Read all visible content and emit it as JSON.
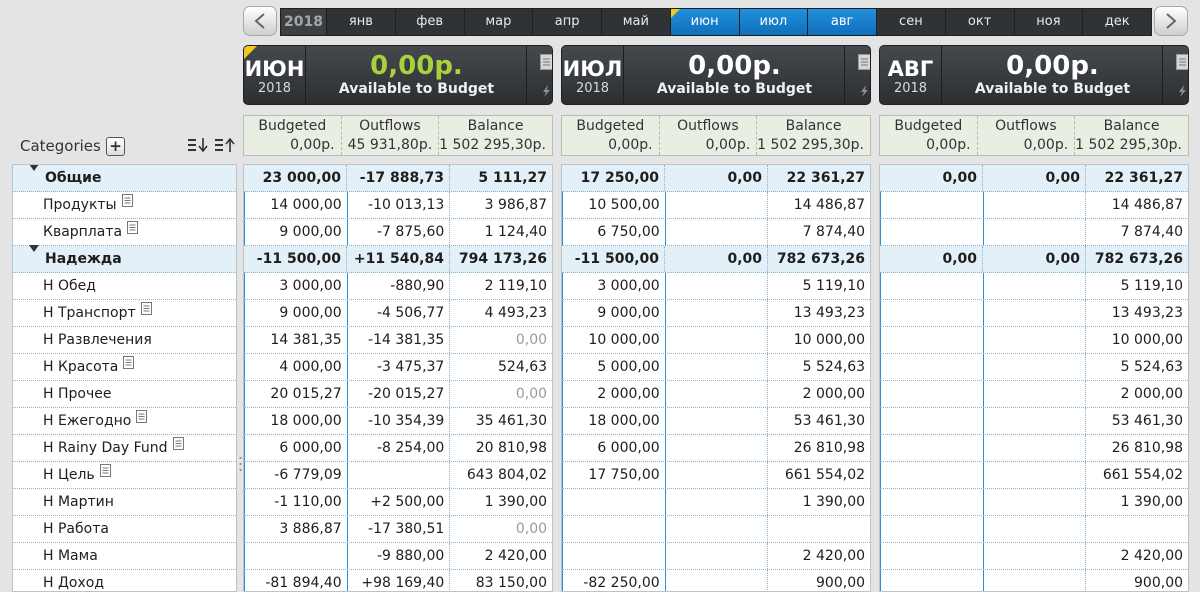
{
  "monthbar": {
    "year": "2018",
    "months": [
      "янв",
      "фев",
      "мар",
      "апр",
      "май",
      "июн",
      "июл",
      "авг",
      "сен",
      "окт",
      "ноя",
      "дек"
    ],
    "active": [
      5,
      6,
      7
    ]
  },
  "months": [
    {
      "name": "ИЮН",
      "year": "2018",
      "amount": "0,00р.",
      "amount_label": "Available to Budget",
      "summary": {
        "budgeted_label": "Budgeted",
        "budgeted": "0,00р.",
        "outflows_label": "Outflows",
        "outflows": "45 931,80р.",
        "balance_label": "Balance",
        "balance": "1 502 295,30р."
      },
      "rows": [
        [
          "23 000,00",
          "-17 888,73",
          "5 111,27"
        ],
        [
          "14 000,00",
          "-10 013,13",
          "3 986,87"
        ],
        [
          "9 000,00",
          "-7 875,60",
          "1 124,40"
        ],
        [
          "-11 500,00",
          "+11 540,84",
          "794 173,26"
        ],
        [
          "3 000,00",
          "-880,90",
          "2 119,10"
        ],
        [
          "9 000,00",
          "-4 506,77",
          "4 493,23"
        ],
        [
          "14 381,35",
          "-14 381,35",
          "0,00"
        ],
        [
          "4 000,00",
          "-3 475,37",
          "524,63"
        ],
        [
          "20 015,27",
          "-20 015,27",
          "0,00"
        ],
        [
          "18 000,00",
          "-10 354,39",
          "35 461,30"
        ],
        [
          "6 000,00",
          "-8 254,00",
          "20 810,98"
        ],
        [
          "-6 779,09",
          "",
          "643 804,02"
        ],
        [
          "-1 110,00",
          "+2 500,00",
          "1 390,00"
        ],
        [
          "3 886,87",
          "-17 380,51",
          "0,00"
        ],
        [
          "",
          "-9 880,00",
          "2 420,00"
        ],
        [
          "-81 894,40",
          "+98 169,40",
          "83 150,00"
        ]
      ]
    },
    {
      "name": "ИЮЛ",
      "year": "2018",
      "amount": "0,00р.",
      "amount_label": "Available to Budget",
      "summary": {
        "budgeted_label": "Budgeted",
        "budgeted": "0,00р.",
        "outflows_label": "Outflows",
        "outflows": "0,00р.",
        "balance_label": "Balance",
        "balance": "1 502 295,30р."
      },
      "rows": [
        [
          "17 250,00",
          "0,00",
          "22 361,27"
        ],
        [
          "10 500,00",
          "",
          "14 486,87"
        ],
        [
          "6 750,00",
          "",
          "7 874,40"
        ],
        [
          "-11 500,00",
          "0,00",
          "782 673,26"
        ],
        [
          "3 000,00",
          "",
          "5 119,10"
        ],
        [
          "9 000,00",
          "",
          "13 493,23"
        ],
        [
          "10 000,00",
          "",
          "10 000,00"
        ],
        [
          "5 000,00",
          "",
          "5 524,63"
        ],
        [
          "2 000,00",
          "",
          "2 000,00"
        ],
        [
          "18 000,00",
          "",
          "53 461,30"
        ],
        [
          "6 000,00",
          "",
          "26 810,98"
        ],
        [
          "17 750,00",
          "",
          "661 554,02"
        ],
        [
          "",
          "",
          "1 390,00"
        ],
        [
          "",
          "",
          ""
        ],
        [
          "",
          "",
          "2 420,00"
        ],
        [
          "-82 250,00",
          "",
          "900,00"
        ]
      ]
    },
    {
      "name": "АВГ",
      "year": "2018",
      "amount": "0,00р.",
      "amount_label": "Available to Budget",
      "summary": {
        "budgeted_label": "Budgeted",
        "budgeted": "0,00р.",
        "outflows_label": "Outflows",
        "outflows": "0,00р.",
        "balance_label": "Balance",
        "balance": "1 502 295,30р."
      },
      "rows": [
        [
          "0,00",
          "0,00",
          "22 361,27"
        ],
        [
          "",
          "",
          "14 486,87"
        ],
        [
          "",
          "",
          "7 874,40"
        ],
        [
          "0,00",
          "0,00",
          "782 673,26"
        ],
        [
          "",
          "",
          "5 119,10"
        ],
        [
          "",
          "",
          "13 493,23"
        ],
        [
          "",
          "",
          "10 000,00"
        ],
        [
          "",
          "",
          "5 524,63"
        ],
        [
          "",
          "",
          "2 000,00"
        ],
        [
          "",
          "",
          "53 461,30"
        ],
        [
          "",
          "",
          "26 810,98"
        ],
        [
          "",
          "",
          "661 554,02"
        ],
        [
          "",
          "",
          "1 390,00"
        ],
        [
          "",
          "",
          ""
        ],
        [
          "",
          "",
          "2 420,00"
        ],
        [
          "",
          "",
          "900,00"
        ]
      ]
    }
  ],
  "categories_header": {
    "label": "Categories",
    "add_label": "+"
  },
  "categories": [
    {
      "label": "Общие",
      "group": true,
      "note": false
    },
    {
      "label": "Продукты",
      "group": false,
      "note": true
    },
    {
      "label": "Кварплата",
      "group": false,
      "note": true
    },
    {
      "label": "Надежда",
      "group": true,
      "note": false
    },
    {
      "label": "Н Обед",
      "group": false,
      "note": false
    },
    {
      "label": "Н Транспорт",
      "group": false,
      "note": true
    },
    {
      "label": "Н Развлечения",
      "group": false,
      "note": false
    },
    {
      "label": "Н Красота",
      "group": false,
      "note": true
    },
    {
      "label": "Н Прочее",
      "group": false,
      "note": false
    },
    {
      "label": "Н Ежегодно",
      "group": false,
      "note": true
    },
    {
      "label": "Н Rainy Day Fund",
      "group": false,
      "note": true
    },
    {
      "label": "Н Цель",
      "group": false,
      "note": true
    },
    {
      "label": "Н Мартин",
      "group": false,
      "note": false
    },
    {
      "label": "Н Работа",
      "group": false,
      "note": false
    },
    {
      "label": "Н Мама",
      "group": false,
      "note": false
    },
    {
      "label": "Н Доход",
      "group": false,
      "note": false
    }
  ],
  "colors": {
    "accent": "#1a7fcf",
    "available_positive": "#a8d13b",
    "header_dark": "#2f3336",
    "marker": "#f3c81b"
  }
}
